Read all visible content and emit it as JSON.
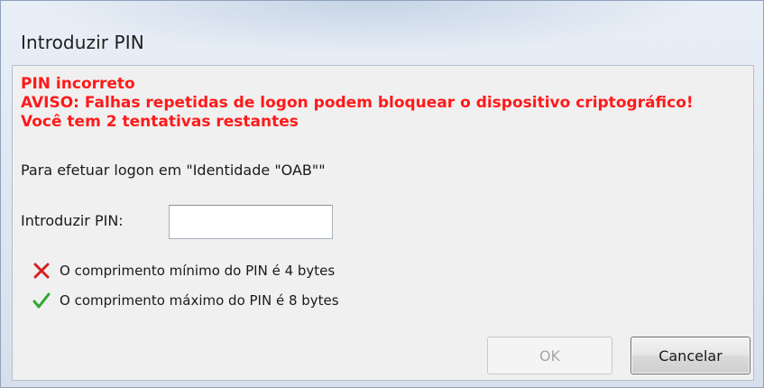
{
  "window": {
    "title": "Introduzir PIN"
  },
  "errors": {
    "line1": "PIN incorreto",
    "line2": "AVISO: Falhas repetidas de logon podem bloquear o dispositivo criptográfico!",
    "line3": "Você tem 2 tentativas restantes"
  },
  "logon_target": "Para efetuar logon em \"Identidade \"OAB\"\"",
  "pin_field": {
    "label": "Introduzir PIN:",
    "value": ""
  },
  "rules": [
    {
      "icon": "red-x-icon",
      "text": "O comprimento mínimo do PIN é 4 bytes",
      "color": "#d32020"
    },
    {
      "icon": "green-check-icon",
      "text": "O comprimento máximo do PIN é 8 bytes",
      "color": "#2fa82f"
    }
  ],
  "buttons": {
    "ok_label": "OK",
    "cancel_label": "Cancelar"
  },
  "colors": {
    "error_text": "#ff1a1a",
    "window_frame": "#dde6f1",
    "client_bg": "#f0f0f0"
  }
}
